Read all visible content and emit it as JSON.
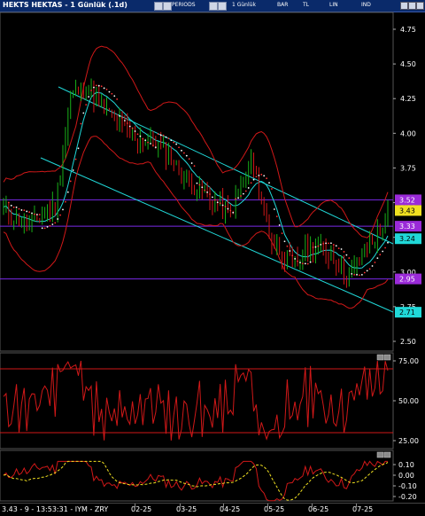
{
  "window": {
    "title": "HEKTS HEKTAS - 1 Günlük (.1d)",
    "toolbar": {
      "label1": "PERIODS",
      "interval": "1 Günlük",
      "style1": "BAR",
      "style2": "TL",
      "style3": "LIN",
      "style4": "IND"
    }
  },
  "price_axis": {
    "ticks": [
      "4.75",
      "4.50",
      "4.25",
      "4.00",
      "3.75",
      "3.50",
      "3.25",
      "3.00",
      "2.75",
      "2.50"
    ]
  },
  "badges": [
    {
      "label": "3.52",
      "bg": "#9a2ad8",
      "fg": "#ffffff"
    },
    {
      "label": "3.43",
      "bg": "#f0e020",
      "fg": "#000000"
    },
    {
      "label": "3.33",
      "bg": "#9a2ad8",
      "fg": "#ffffff"
    },
    {
      "label": "3.24",
      "bg": "#20d8d8",
      "fg": "#000000"
    },
    {
      "label": "2.95",
      "bg": "#9a2ad8",
      "fg": "#ffffff"
    },
    {
      "label": "2.71",
      "bg": "#20d8d8",
      "fg": "#000000"
    }
  ],
  "rsi_axis": {
    "ticks": [
      "75.00",
      "50.00",
      "25.00"
    ]
  },
  "osc_axis": {
    "ticks": [
      "0.10",
      "0.00",
      "-0.10",
      "-0.20"
    ]
  },
  "status": {
    "text": "3.43 - 9 - 13:53:31 - IYM - ZRY"
  },
  "dates": [
    "02-25",
    "03-25",
    "04-25",
    "05-25",
    "06-25",
    "07-25"
  ],
  "colors": {
    "purple": "#7a2ae8",
    "cyan": "#20d8d8",
    "red": "#d01818",
    "green": "#18b018",
    "yellow": "#f0e020"
  }
}
